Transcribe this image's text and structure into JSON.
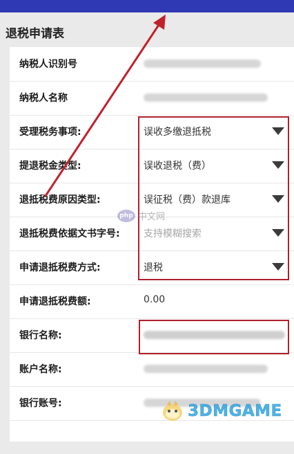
{
  "form": {
    "title": "退税申请表",
    "fields": [
      {
        "label": "纳税人识别号",
        "value": ""
      },
      {
        "label": "纳税人名称",
        "value": ""
      },
      {
        "label": "受理税务事项:",
        "value": "误收多缴退抵税"
      },
      {
        "label": "提退税金类型:",
        "value": "误收退税（费）"
      },
      {
        "label": "退抵税费原因类型:",
        "value": "误征税（费）款退库"
      },
      {
        "label": "退抵税费依据文书字号:",
        "placeholder": "支持模糊搜索"
      },
      {
        "label": "申请退抵税费方式:",
        "value": "退税"
      },
      {
        "label": "申请退抵税费额:",
        "value": "0.00"
      },
      {
        "label": "银行名称:",
        "value": ""
      },
      {
        "label": "账户名称:",
        "value": ""
      },
      {
        "label": "银行账号:",
        "value": ""
      }
    ]
  },
  "watermarks": {
    "php_logo": "php",
    "php_text": "中文网",
    "game_brand": "3DMGAME"
  },
  "colors": {
    "top_bar": "#2f39b3",
    "highlight_box": "#b0202a",
    "annotation_arrow": "#c0222c",
    "brand": "#2fa6e3"
  }
}
